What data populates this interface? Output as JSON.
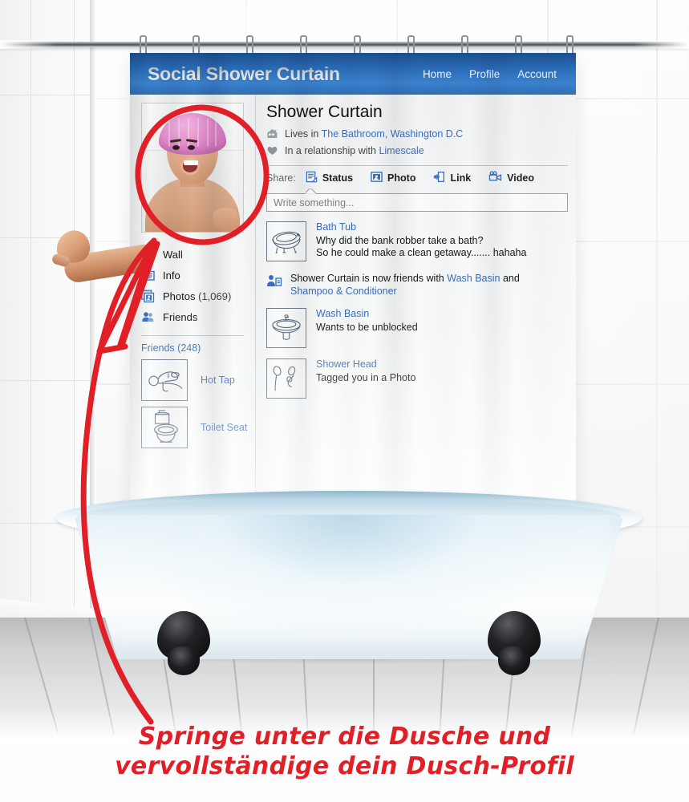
{
  "app": {
    "title": "Social Shower Curtain",
    "nav": [
      {
        "label": "Home"
      },
      {
        "label": "Profile"
      },
      {
        "label": "Account"
      }
    ]
  },
  "profile": {
    "name": "Shower Curtain",
    "avatar_alt": "man-in-pink-shower-cap",
    "meta": [
      {
        "icon": "house-icon",
        "prefix": "Lives in ",
        "link": "The Bathroom, Washington D.C"
      },
      {
        "icon": "heart-icon",
        "prefix": "In a relationship with ",
        "link": "Limescale"
      }
    ]
  },
  "sidebar": {
    "nav": [
      {
        "icon": "speech-bubble-icon",
        "label": "Wall",
        "count": ""
      },
      {
        "icon": "id-card-icon",
        "label": "Info",
        "count": ""
      },
      {
        "icon": "photo-frame-icon",
        "label": "Photos",
        "count": "(1,069)"
      },
      {
        "icon": "people-icon",
        "label": "Friends",
        "count": ""
      }
    ],
    "friends_heading": "Friends (248)",
    "friends": [
      {
        "thumb": "hot-tap-icon",
        "name": "Hot Tap"
      },
      {
        "thumb": "toilet-seat-icon",
        "name": "Toilet Seat"
      }
    ]
  },
  "share": {
    "label": "Share:",
    "items": [
      {
        "icon": "status-icon",
        "label": "Status"
      },
      {
        "icon": "photo-icon",
        "label": "Photo"
      },
      {
        "icon": "link-icon",
        "label": "Link"
      },
      {
        "icon": "video-icon",
        "label": "Video"
      }
    ]
  },
  "composer": {
    "placeholder": "Write something...",
    "value": ""
  },
  "feed": [
    {
      "kind": "post",
      "thumb": "bath-tub-icon",
      "author": "Bath Tub",
      "line1": "Why did the bank robber take a bath?",
      "line2": "So he could make a clean getaway....... hahaha"
    },
    {
      "kind": "story",
      "icon": "friend-add-icon",
      "text_1": "Shower Curtain is now friends with ",
      "link_1": "Wash Basin",
      "text_2": " and",
      "link_2": "Shampoo & Conditioner"
    },
    {
      "kind": "post",
      "thumb": "wash-basin-icon",
      "author": "Wash Basin",
      "line1": "Wants to be unblocked",
      "line2": ""
    },
    {
      "kind": "post",
      "thumb": "shower-head-icon",
      "author": "Shower Head",
      "line1": "Tagged you in a Photo",
      "line2": ""
    }
  ],
  "caption": {
    "line1": "Springe unter die Dusche und",
    "line2": "vervollständige dein Dusch-Profil"
  },
  "colors": {
    "header_blue": "#2a6cb8",
    "link_blue": "#3a6fbd",
    "annotation_red": "#e11f26",
    "cap_pink": "#e78fd0",
    "tub_blue": "#d9eaf2"
  },
  "scene": {
    "rod": "curtain-rod",
    "rings": 9,
    "tub": "claw-foot-bathtub",
    "arm": "arm-reaching-out-of-curtain"
  }
}
